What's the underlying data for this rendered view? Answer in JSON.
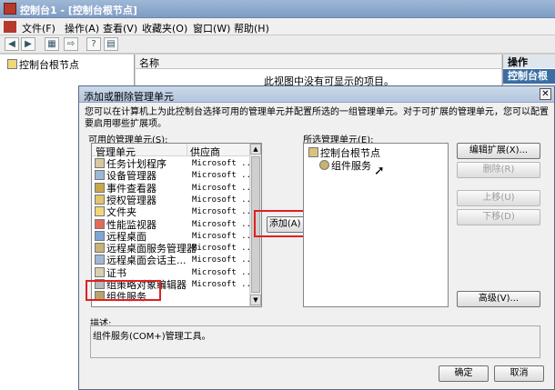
{
  "window": {
    "title": "控制台1 - [控制台根节点]"
  },
  "menu": [
    "文件(F)",
    "操作(A)",
    "查看(V)",
    "收藏夹(O)",
    "窗口(W)",
    "帮助(H)"
  ],
  "left_tree": {
    "root": "控制台根节点"
  },
  "center": {
    "col_name": "名称",
    "empty_text": "此视图中没有可显示的项目。"
  },
  "actions": {
    "header": "操作",
    "item": "控制台根节点"
  },
  "dialog": {
    "title": "添加或删除管理单元",
    "close": "✕",
    "intro": "您可以在计算机上为此控制台选择可用的管理单元并配置所选的一组管理单元。对于可扩展的管理单元，您可以配置要启用哪些扩展项。",
    "available_label": "可用的管理单元(S):",
    "col_snapin": "管理单元",
    "col_vendor": "供应商",
    "available": [
      {
        "name": "任务计划程序",
        "vendor": "Microsoft ..."
      },
      {
        "name": "设备管理器",
        "vendor": "Microsoft ..."
      },
      {
        "name": "事件查看器",
        "vendor": "Microsoft ..."
      },
      {
        "name": "授权管理器",
        "vendor": "Microsoft ..."
      },
      {
        "name": "文件夹",
        "vendor": "Microsoft ..."
      },
      {
        "name": "性能监视器",
        "vendor": "Microsoft ..."
      },
      {
        "name": "远程桌面",
        "vendor": "Microsoft ..."
      },
      {
        "name": "远程桌面服务管理器",
        "vendor": "Microsoft ..."
      },
      {
        "name": "远程桌面会话主...",
        "vendor": "Microsoft ..."
      },
      {
        "name": "证书",
        "vendor": "Microsoft ..."
      },
      {
        "name": "组策略对象编辑器",
        "vendor": "Microsoft ..."
      },
      {
        "name": "组件服务",
        "vendor": ""
      }
    ],
    "add_button": "添加(A) >",
    "selected_label": "所选管理单元(E):",
    "selected_root": "控制台根节点",
    "selected_child": "组件服务",
    "buttons": {
      "edit_ext": "编辑扩展(X)...",
      "remove": "删除(R)",
      "move_up": "上移(U)",
      "move_down": "下移(D)",
      "advanced": "高级(V)...",
      "ok": "确定",
      "cancel": "取消"
    },
    "desc_label": "描述:",
    "desc_text": "组件服务(COM+)管理工具。"
  },
  "colors": {
    "highlight_box": "#e0201f",
    "action_bar": "#3a6ea5"
  }
}
